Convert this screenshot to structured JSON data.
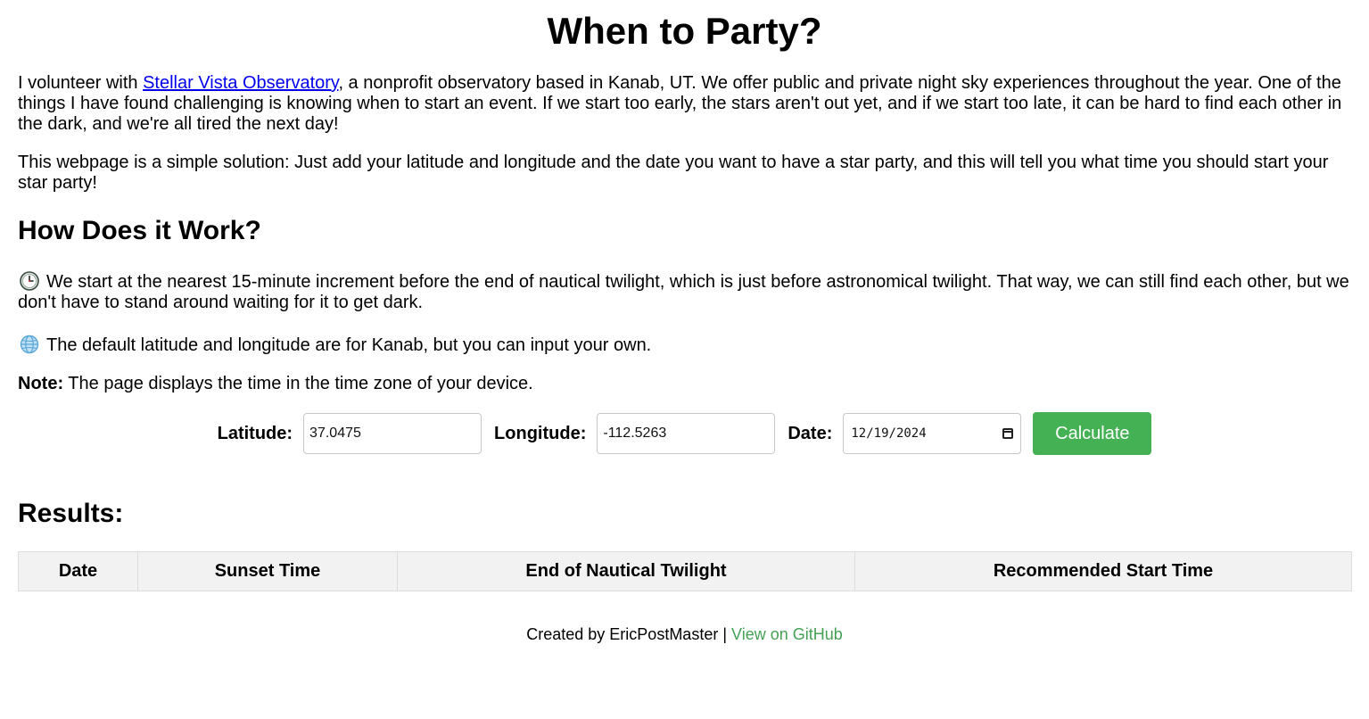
{
  "title": "When to Party?",
  "intro": {
    "p1_before_link": "I volunteer with ",
    "p1_link": "Stellar Vista Observatory",
    "p1_after_link": ", a nonprofit observatory based in Kanab, UT. We offer public and private night sky experiences throughout the year. One of the things I have found challenging is knowing when to start an event. If we start too early, the stars aren't out yet, and if we start too late, it can be hard to find each other in the dark, and we're all tired the next day!",
    "p2": "This webpage is a simple solution: Just add your latitude and longitude and the date you want to have a star party, and this will tell you what time you should start your star party!"
  },
  "how": {
    "heading": "How Does it Work?",
    "bullet1": "We start at the nearest 15-minute increment before the end of nautical twilight, which is just before astronomical twilight. That way, we can still find each other, but we don't have to stand around waiting for it to get dark.",
    "bullet1_icon": "clock-icon",
    "bullet2": "The default latitude and longitude are for Kanab, but you can input your own.",
    "bullet2_icon": "globe-icon",
    "note_label": "Note:",
    "note_text": " The page displays the time in the time zone of your device."
  },
  "form": {
    "latitude_label": "Latitude:",
    "latitude_value": "37.0475",
    "longitude_label": "Longitude:",
    "longitude_value": "-112.5263",
    "date_label": "Date:",
    "date_value": "12/19/2024",
    "calculate_label": "Calculate",
    "button_color": "#44b154"
  },
  "results": {
    "heading": "Results:",
    "columns": [
      "Date",
      "Sunset Time",
      "End of Nautical Twilight",
      "Recommended Start Time"
    ]
  },
  "footer": {
    "created_by": "Created by EricPostMaster | ",
    "github_link": "View on GitHub",
    "link_color": "#44a154"
  }
}
